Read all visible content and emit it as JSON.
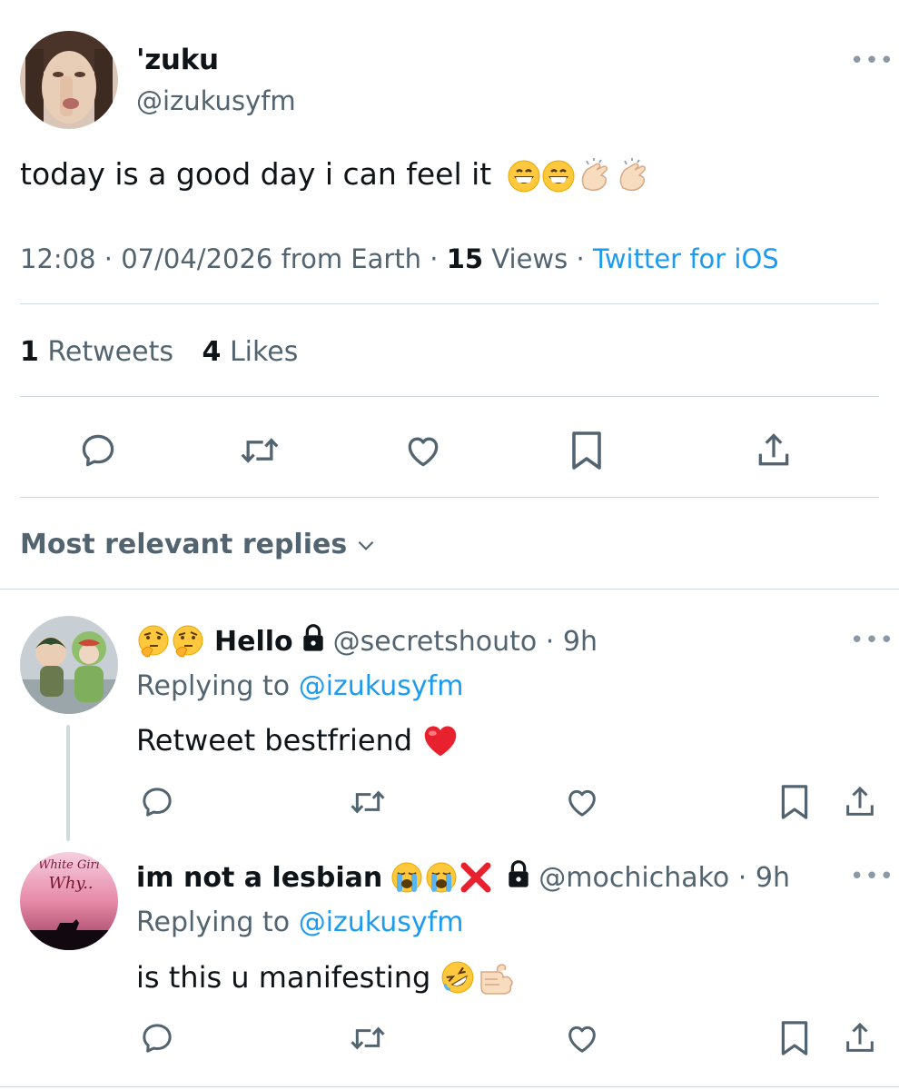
{
  "main_tweet": {
    "author": {
      "display_name": "'zuku",
      "handle": "@izukusyfm"
    },
    "text": "today is a good day i can feel it",
    "text_emojis": [
      "grinning-face",
      "grinning-face",
      "clapping-hands",
      "clapping-hands"
    ],
    "meta": {
      "time_date": "12:08 · 07/04/2026 from Earth · ",
      "views_count": "15",
      "views_label": " Views · ",
      "source": "Twitter for iOS"
    },
    "stats": {
      "retweets_count": "1",
      "retweets_label": " Retweets",
      "likes_count": "4",
      "likes_label": " Likes"
    }
  },
  "actions": {
    "icons": [
      "reply-icon",
      "retweet-icon",
      "like-icon",
      "bookmark-icon",
      "share-icon"
    ]
  },
  "replies_sort": {
    "label": "Most relevant replies"
  },
  "replies": [
    {
      "name_emojis": [
        "thinking-face",
        "thinking-face"
      ],
      "display_name": "Hello",
      "protected": true,
      "handle_time": "@secretshouto · 9h",
      "replying_prefix": "Replying to",
      "replying_handle": "@izukusyfm",
      "text": "Retweet bestfriend",
      "text_emojis": [
        "red-heart"
      ]
    },
    {
      "display_name": "im not a lesbian",
      "name_emojis": [
        "loudly-crying-face",
        "loudly-crying-face",
        "cross-mark"
      ],
      "protected": true,
      "handle_time": "@mochichako · 9h",
      "replying_prefix": "Replying to",
      "replying_handle": "@izukusyfm",
      "text": "is this u manifesting",
      "text_emojis": [
        "rolling-on-floor-laughing",
        "pointing-fist"
      ],
      "avatar_text": [
        "White Girl",
        "Why.."
      ]
    }
  ],
  "colors": {
    "text": "#0f1419",
    "secondary": "#536471",
    "link": "#1d9bf0",
    "divider": "#cfd9de"
  }
}
